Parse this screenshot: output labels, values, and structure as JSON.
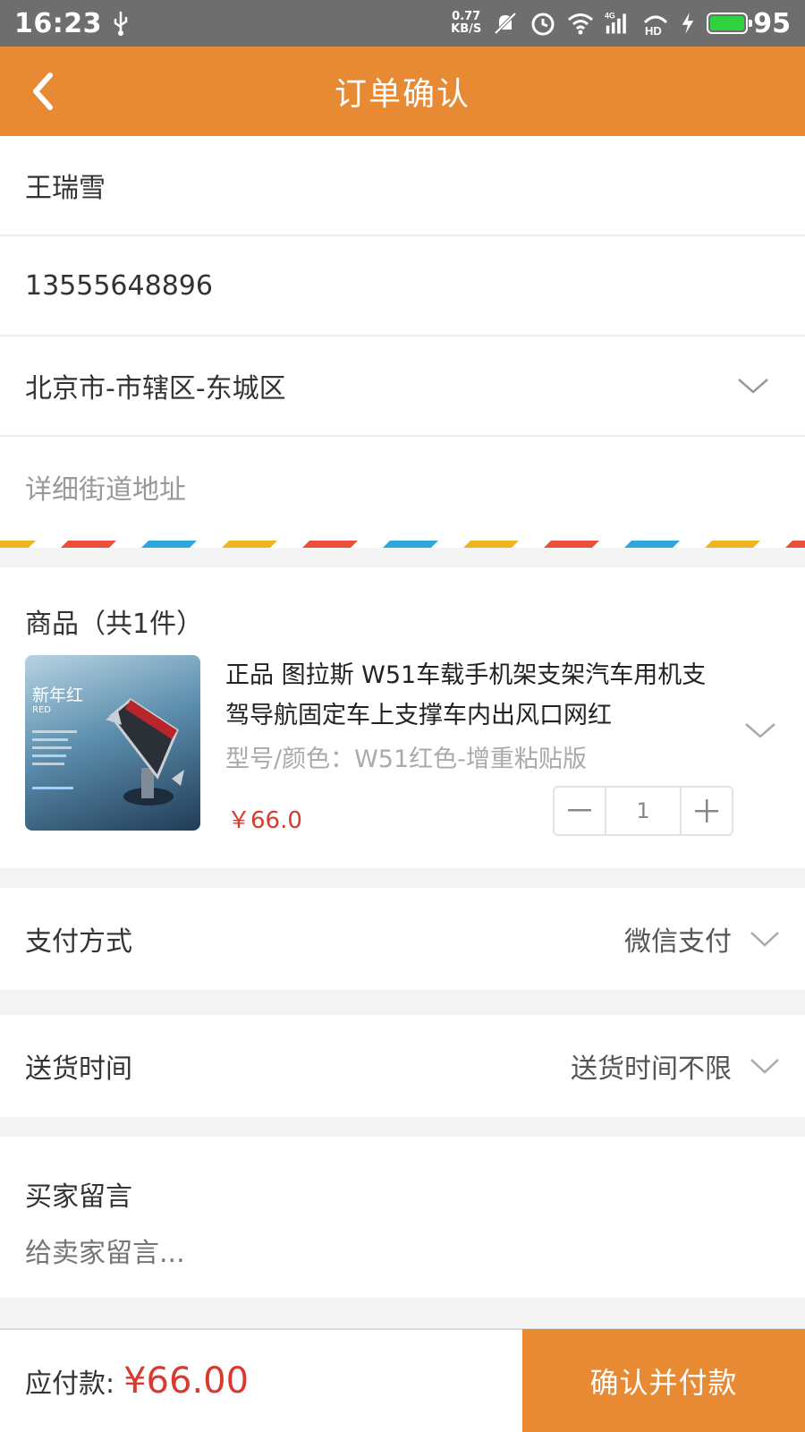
{
  "status_bar": {
    "time": "16:23",
    "net_speed_value": "0.77",
    "net_speed_unit": "KB/S",
    "network": "4G",
    "hd": "HD",
    "battery_level": "95",
    "icons": [
      "usb-icon",
      "mute-icon",
      "alarm-icon",
      "wifi-icon",
      "signal-icon",
      "hd-icon",
      "charging-icon",
      "battery-icon"
    ]
  },
  "nav": {
    "title": "订单确认",
    "back_icon": "back-chevron-icon"
  },
  "address": {
    "name": "王瑞雪",
    "phone": "13555648896",
    "region": "北京市-市辖区-东城区",
    "street_placeholder": "详细街道地址"
  },
  "goods": {
    "header": "商品（共1件）",
    "items": [
      {
        "name": "正品 图拉斯 W51车载手机架支架汽车用机支驾导航固定车上支撑车内出风口网红",
        "spec": "型号/颜色：W51红色-增重粘贴版",
        "price": "￥66.0",
        "quantity": "1",
        "image": {
          "title": "新年红",
          "subtitle": "RED"
        }
      }
    ]
  },
  "payment": {
    "label": "支付方式",
    "value": "微信支付"
  },
  "delivery": {
    "label": "送货时间",
    "value": "送货时间不限"
  },
  "message": {
    "label": "买家留言",
    "placeholder": "给卖家留言..."
  },
  "footer": {
    "total_label": "应付款:",
    "total_amount": "¥66.00",
    "confirm_button": "确认并付款"
  },
  "colors": {
    "accent": "#e88a34",
    "price": "#d83a2f",
    "status_bar": "#6e6e6e",
    "airmail_stripes": [
      "#f0b423",
      "#e8503c",
      "#2fa6dc"
    ]
  }
}
